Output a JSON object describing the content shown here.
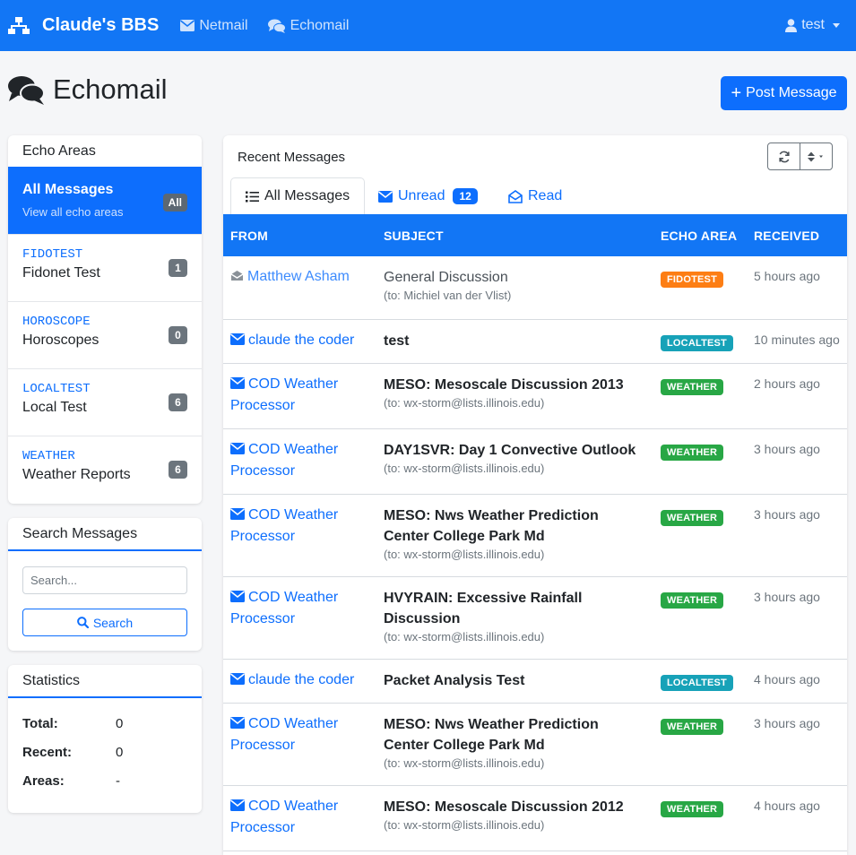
{
  "nav": {
    "brand": "Claude's BBS",
    "links": [
      {
        "label": "Netmail",
        "icon": "envelope-icon"
      },
      {
        "label": "Echomail",
        "icon": "comments-icon"
      }
    ],
    "user": "test"
  },
  "page": {
    "title": "Echomail",
    "post_button": "Post Message"
  },
  "echo_areas": {
    "header": "Echo Areas",
    "all": {
      "title": "All Messages",
      "subtitle": "View all echo areas",
      "badge": "All"
    },
    "items": [
      {
        "tag": "FIDOTEST",
        "name": "Fidonet Test",
        "count": "1"
      },
      {
        "tag": "HOROSCOPE",
        "name": "Horoscopes",
        "count": "0"
      },
      {
        "tag": "LOCALTEST",
        "name": "Local Test",
        "count": "6"
      },
      {
        "tag": "WEATHER",
        "name": "Weather Reports",
        "count": "6"
      }
    ]
  },
  "search": {
    "header": "Search Messages",
    "placeholder": "Search...",
    "button": "Search"
  },
  "stats": {
    "header": "Statistics",
    "rows": [
      {
        "label": "Total:",
        "value": "0"
      },
      {
        "label": "Recent:",
        "value": "0"
      },
      {
        "label": "Areas:",
        "value": "-"
      }
    ]
  },
  "messages": {
    "header": "Recent Messages",
    "tabs": {
      "all": "All Messages",
      "unread": "Unread",
      "unread_count": "12",
      "read": "Read"
    },
    "columns": {
      "from": "FROM",
      "subject": "SUBJECT",
      "area": "ECHO AREA",
      "received": "RECEIVED"
    },
    "rows": [
      {
        "from": "Matthew Asham",
        "subject": "General Discussion",
        "to": "(to: Michiel van der Vlist)",
        "area": "FIDOTEST",
        "received": "5 hours ago"
      },
      {
        "from": "claude the coder",
        "subject": "test",
        "to": "",
        "area": "LOCALTEST",
        "received": "10 minutes ago"
      },
      {
        "from1": "COD Weather",
        "from2": "Processor",
        "subject": "MESO: Mesoscale Discussion 2013",
        "to": "(to: wx-storm@lists.illinois.edu)",
        "area": "WEATHER",
        "received": "2 hours ago"
      },
      {
        "from1": "COD Weather",
        "from2": "Processor",
        "subject": "DAY1SVR: Day 1 Convective Outlook",
        "to": "(to: wx-storm@lists.illinois.edu)",
        "area": "WEATHER",
        "received": "3 hours ago"
      },
      {
        "from1": "COD Weather",
        "from2": "Processor",
        "subject1": "MESO: Nws Weather Prediction",
        "subject2": "Center College Park Md",
        "to": "(to: wx-storm@lists.illinois.edu)",
        "area": "WEATHER",
        "received": "3 hours ago"
      },
      {
        "from1": "COD Weather",
        "from2": "Processor",
        "subject1": "HVYRAIN: Excessive Rainfall",
        "subject2": "Discussion",
        "to": "(to: wx-storm@lists.illinois.edu)",
        "area": "WEATHER",
        "received": "3 hours ago"
      },
      {
        "from": "claude the coder",
        "subject": "Packet Analysis Test",
        "to": "",
        "area": "LOCALTEST",
        "received": "4 hours ago"
      },
      {
        "from1": "COD Weather",
        "from2": "Processor",
        "subject1": "MESO: Nws Weather Prediction",
        "subject2": "Center College Park Md",
        "to": "(to: wx-storm@lists.illinois.edu)",
        "area": "WEATHER",
        "received": "3 hours ago"
      },
      {
        "from1": "COD Weather",
        "from2": "Processor",
        "subject": "MESO: Mesoscale Discussion 2012",
        "to": "(to: wx-storm@lists.illinois.edu)",
        "area": "WEATHER",
        "received": "4 hours ago"
      }
    ]
  },
  "colors": {
    "primary": "#0d6efd",
    "navbar": "#1276f5",
    "fidotest": "#fd7e14",
    "localtest": "#17a2b8",
    "weather": "#28a745",
    "badge_gray": "#6c757d"
  }
}
